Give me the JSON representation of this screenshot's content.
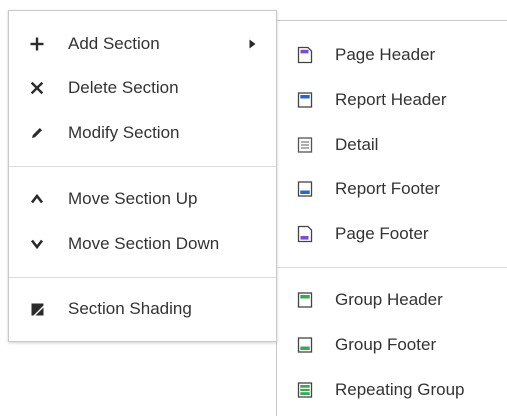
{
  "main_menu": {
    "add_section": "Add Section",
    "delete_section": "Delete Section",
    "modify_section": "Modify Section",
    "move_section_up": "Move Section Up",
    "move_section_down": "Move Section Down",
    "section_shading": "Section Shading"
  },
  "submenu": {
    "page_header": "Page Header",
    "report_header": "Report Header",
    "detail": "Detail",
    "report_footer": "Report Footer",
    "page_footer": "Page Footer",
    "group_header": "Group Header",
    "group_footer": "Group Footer",
    "repeating_group": "Repeating Group"
  },
  "icons": {
    "add": "plus-icon",
    "delete": "close-icon",
    "modify": "pencil-icon",
    "move_up": "chevron-up-icon",
    "move_down": "chevron-down-icon",
    "shading": "shading-icon",
    "submenu_arrow": "caret-right-icon"
  },
  "colors": {
    "text": "#333333",
    "icon_dark": "#2b2b2b",
    "page_accent": "#7b4fc9",
    "report_accent": "#2f63c4",
    "detail_gray": "#777777",
    "group_accent": "#3aa65a"
  }
}
